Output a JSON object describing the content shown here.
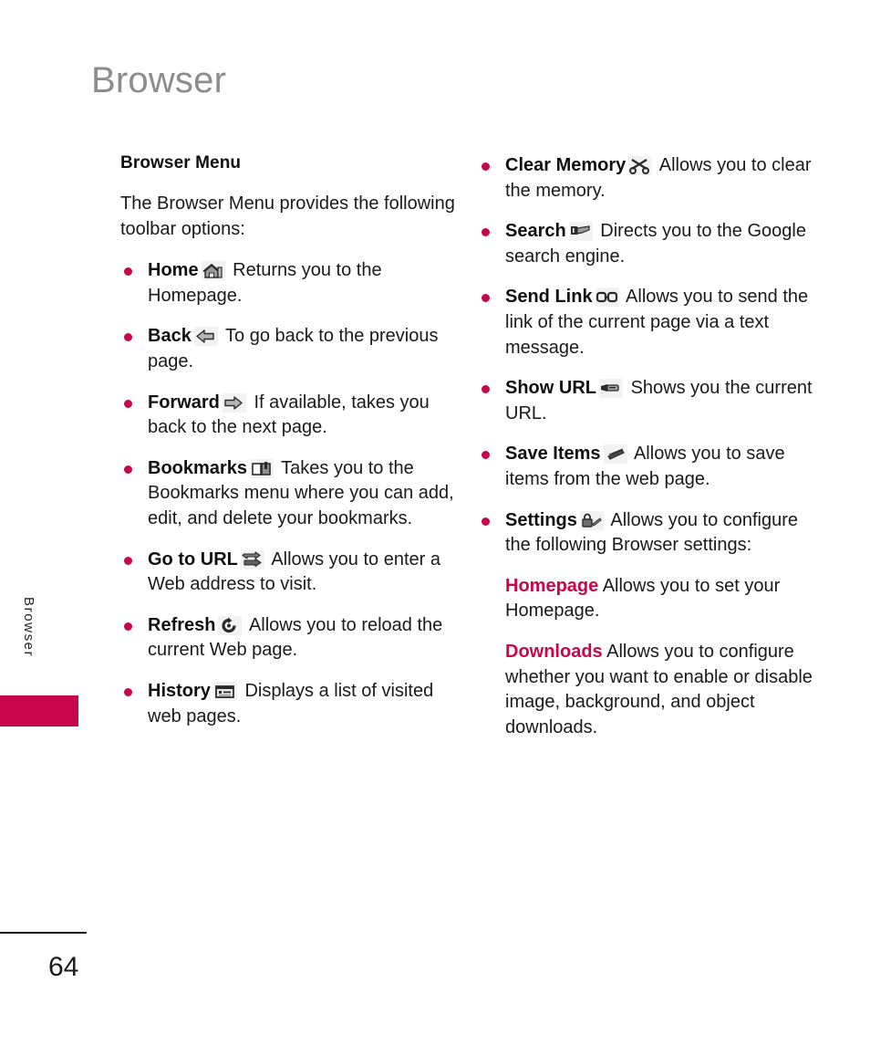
{
  "page": {
    "title": "Browser",
    "number": "64",
    "side_tab_label": "Browser",
    "accent_color": "#c8064b",
    "title_color": "#8c8c8c"
  },
  "left_column": {
    "section_title": "Browser Menu",
    "intro": "The Browser Menu provides the following toolbar options:",
    "items": [
      {
        "term": "Home",
        "icon": "house-icon",
        "description": "Returns you to the Homepage."
      },
      {
        "term": "Back",
        "icon": "left-arrow-icon",
        "description": "To go back to the previous page."
      },
      {
        "term": "Forward",
        "icon": "right-arrow-icon",
        "description": "If available, takes you back to the next page."
      },
      {
        "term": "Bookmarks",
        "icon": "open-book-icon",
        "description": "Takes you to the Bookmarks menu where you can add, edit, and delete your bookmarks."
      },
      {
        "term": "Go to URL",
        "icon": "goto-arrow-icon",
        "description": "Allows you to enter a Web address to visit."
      },
      {
        "term": "Refresh",
        "icon": "refresh-icon",
        "description": "Allows you to reload the current Web page."
      },
      {
        "term": "History",
        "icon": "history-card-icon",
        "description": "Displays a list of visited web pages."
      }
    ]
  },
  "right_column": {
    "items": [
      {
        "term": "Clear Memory",
        "icon": "scissors-icon",
        "description": "Allows you to clear the memory."
      },
      {
        "term": "Search",
        "icon": "search-magnifier-icon",
        "description": "Directs you to the Google search engine."
      },
      {
        "term": "Send Link",
        "icon": "chain-link-icon",
        "description": "Allows you to send the link of the current page via a text message."
      },
      {
        "term": "Show URL",
        "icon": "show-url-icon",
        "description": "Shows you the current URL."
      },
      {
        "term": "Save Items",
        "icon": "save-items-icon",
        "description": "Allows you to save items from the web page."
      },
      {
        "term": "Settings",
        "icon": "padlock-icon",
        "description": "Allows you to configure the following Browser settings:"
      }
    ],
    "settings_sub_items": [
      {
        "term": "Homepage",
        "description": "Allows you to set your Homepage."
      },
      {
        "term": "Downloads",
        "description": "Allows you to configure whether you want to enable or disable image, background, and object downloads."
      }
    ]
  }
}
